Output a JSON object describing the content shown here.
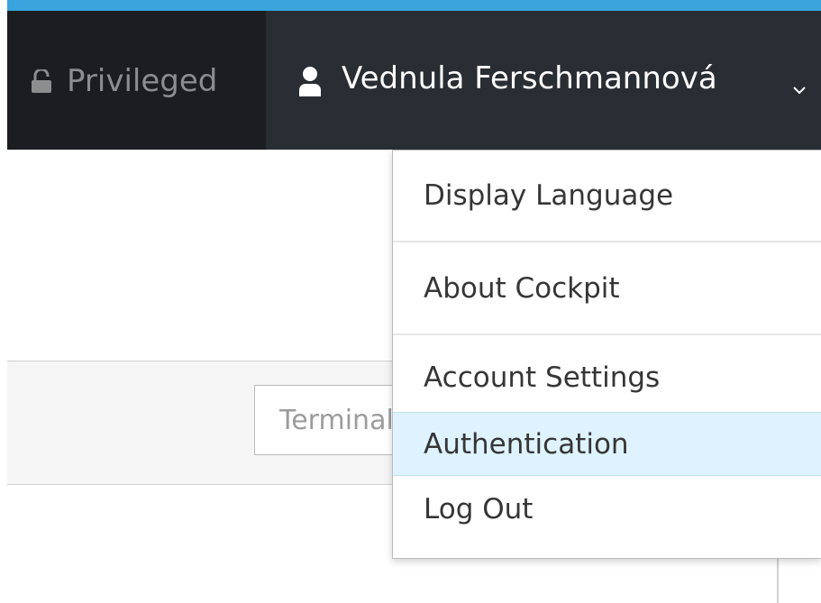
{
  "topbar": {
    "privileged_label": "Privileged",
    "user_name": "Vednula Ferschmannová",
    "lock_icon": "lock-open-icon",
    "user_icon": "user-icon",
    "chevron_icon": "chevron-down-icon"
  },
  "toolbar": {
    "terminal_input_text": "Terminal"
  },
  "dropdown": {
    "items": [
      {
        "label": "Display Language"
      },
      {
        "label": "About Cockpit"
      },
      {
        "label": "Account Settings"
      },
      {
        "label": "Authentication",
        "active": true
      },
      {
        "label": "Log Out"
      }
    ]
  },
  "colors": {
    "accent": "#39a5dc",
    "topbar_bg": "#292e34",
    "topbar_left_bg": "#1b1d21",
    "active_item_bg": "#def3ff"
  }
}
